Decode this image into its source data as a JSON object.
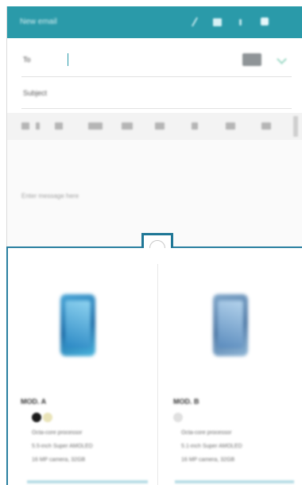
{
  "email": {
    "app_title": "New email",
    "toolbar_icons": [
      "attach-icon",
      "drafts-icon",
      "gallery-icon",
      "send-icon"
    ],
    "to_label": "To",
    "subject_placeholder": "Subject",
    "body_placeholder": "Enter message here"
  },
  "store": {
    "products": [
      {
        "name": "MOD. A",
        "swatches": [
          "#1a1a1a",
          "#e9e3b8"
        ],
        "specs": [
          "Octa-core processor",
          "5.5-inch Super AMOLED",
          "16 MP camera, 32GB"
        ]
      },
      {
        "name": "MOD. B",
        "swatches": [
          "#e0e0e0"
        ],
        "specs": [
          "Octa-core processor",
          "5.1-inch Super AMOLED",
          "16 MP camera, 32GB"
        ]
      }
    ]
  },
  "colors": {
    "accent": "#2a9aa9",
    "splitter": "#1f7796"
  }
}
